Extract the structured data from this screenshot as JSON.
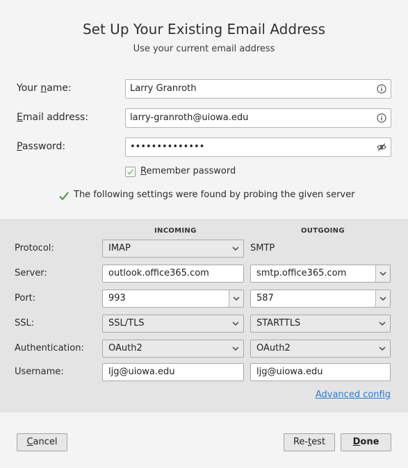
{
  "dialog": {
    "title": "Set Up Your Existing Email Address",
    "subtitle": "Use your current email address"
  },
  "form": {
    "name": {
      "label_pre": "Your ",
      "label_u": "n",
      "label_post": "ame:",
      "value": "Larry Granroth"
    },
    "email": {
      "label_pre": "",
      "label_u": "E",
      "label_post": "mail address:",
      "value": "larry-granroth@uiowa.edu"
    },
    "password": {
      "label_pre": "",
      "label_u": "P",
      "label_post": "assword:",
      "value": "••••••••••••••"
    },
    "remember": {
      "label_pre": "",
      "label_u": "R",
      "label_post": "emember password",
      "checked": true
    }
  },
  "found_message": "The following settings were found by probing the given server",
  "settings": {
    "incoming_header": "INCOMING",
    "outgoing_header": "OUTGOING",
    "labels": {
      "protocol": "Protocol:",
      "server": "Server:",
      "port": "Port:",
      "ssl": "SSL:",
      "authentication": "Authentication:",
      "username": "Username:"
    },
    "incoming": {
      "protocol": "IMAP",
      "server": "outlook.office365.com",
      "port": "993",
      "ssl": "SSL/TLS",
      "authentication": "OAuth2",
      "username": "ljg@uiowa.edu"
    },
    "outgoing": {
      "protocol": "SMTP",
      "server": "smtp.office365.com",
      "port": "587",
      "ssl": "STARTTLS",
      "authentication": "OAuth2",
      "username": "ljg@uiowa.edu"
    },
    "advanced_link": "Advanced config"
  },
  "buttons": {
    "cancel": {
      "pre": "",
      "u": "C",
      "post": "ancel"
    },
    "retest": {
      "pre": "Re-",
      "u": "t",
      "post": "est"
    },
    "done": {
      "pre": "",
      "u": "D",
      "post": "one"
    }
  },
  "colors": {
    "link": "#2a7bd0",
    "check": "#3a9a3a"
  }
}
